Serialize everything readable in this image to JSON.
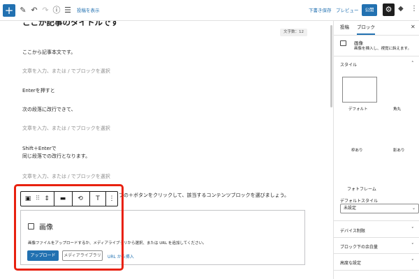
{
  "toolbar": {
    "inserter": "+",
    "edit_icon": "✎",
    "undo_icon": "↶",
    "redo_icon": "↷",
    "info_icon": "ⓘ",
    "list_icon": "☰",
    "show_post_link": "投稿を表示",
    "draft_save": "下書き保存",
    "preview": "プレビュー",
    "publish": "公開",
    "settings_icon": "⚙",
    "plugin_icon": "◆",
    "more_icon": "⋮"
  },
  "editor": {
    "title": "ここが記事のタイトルです",
    "word_count": "文字数：12",
    "paragraphs": [
      {
        "text": "ここから記事本文です。",
        "placeholder": false
      },
      {
        "text": "文章を入力、または / でブロックを選択",
        "placeholder": true
      },
      {
        "text": "Enterを押すと",
        "placeholder": false
      },
      {
        "text": "次の段落に改行できて、",
        "placeholder": false
      },
      {
        "text": "文章を入力、または / でブロックを選択",
        "placeholder": true
      },
      {
        "text": "Shift＋Enterで",
        "placeholder": false
      },
      {
        "text": "同じ段落での改行となります。",
        "placeholder": false
      },
      {
        "text": "文章を入力、または / でブロックを選択",
        "placeholder": true
      },
      {
        "text": "ブの＋ボタンをクリックして、該当するコンテンツブロックを選びましょう。",
        "placeholder": false
      }
    ]
  },
  "block_toolbar": {
    "image_icon": "▣",
    "drag_icon": "⠿",
    "move_icon": "⇕",
    "align_icon": "▬",
    "replace_icon": "⟲",
    "text_icon": "T",
    "more_icon": "⋮"
  },
  "image_block": {
    "title": "画像",
    "description": "画像ファイルをアップロードするか、メディアライブラリから選択、または URL を追加してください。",
    "upload_label": "アップロード",
    "media_label": "メディアライブラリ",
    "url_label": "URL から挿入"
  },
  "sidebar": {
    "tab_post": "投稿",
    "tab_block": "ブロック",
    "close_icon": "✕",
    "block_name": "画像",
    "block_desc": "画像を挿入し、視覚に訴えます。",
    "styles_title": "スタイル",
    "chevron_up": "˄",
    "chevron_down": "˅",
    "styles": {
      "default": "デフォルト",
      "rounded": "角丸",
      "frame": "枠あり",
      "shadow": "影あり"
    },
    "photo_frame": "フォトフレーム",
    "default_style_label": "デフォルトスタイル",
    "default_style_value": "未設定",
    "select_arrow": "⌄",
    "sections": [
      "デバイス制限",
      "ブロック下の余白量",
      "高度な設定"
    ]
  },
  "colors": {
    "accent": "#2271b1",
    "highlight": "#e8210f"
  }
}
